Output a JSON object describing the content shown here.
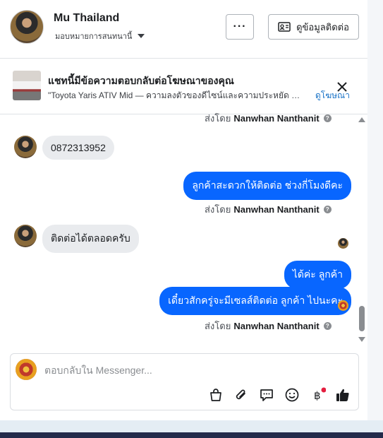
{
  "header": {
    "page_name": "Mu Thailand",
    "assignment_label": "มอบหมายการสนทนานี้",
    "more_label": "···",
    "contact_label": "ดูข้อมูลติดต่อ"
  },
  "ad_banner": {
    "title": "แชทนี้มีข้อความตอบกลับต่อโฆษณาของคุณ",
    "description": "\"Toyota Yaris ATIV Mid — ความลงตัวของดีไซน์และความประหยัด ✨\" ...",
    "view_ad_label": "ดูโฆษณา"
  },
  "messages": [
    {
      "type": "sent_by",
      "prefix": "ส่งโดย",
      "name": "Nanwhan Nanthanit"
    },
    {
      "type": "incoming",
      "text": "0872313952"
    },
    {
      "type": "outgoing",
      "text": "ลูกค้าสะดวกให้ติดต่อ ช่วงกี่โมงดีคะ"
    },
    {
      "type": "sent_by",
      "prefix": "ส่งโดย",
      "name": "Nanwhan Nanthanit"
    },
    {
      "type": "incoming",
      "text": "ติดต่อได้ตลอดครับ"
    },
    {
      "type": "outgoing",
      "text": "ได้ค่ะ  ลูกค้า"
    },
    {
      "type": "outgoing",
      "text": "เดี๋ยวสักครู่จะมีเซลส์ติดต่อ ลูกค้า  ไปนะคะ"
    },
    {
      "type": "sent_by",
      "prefix": "ส่งโดย",
      "name": "Nanwhan Nanthanit"
    }
  ],
  "composer": {
    "placeholder": "ตอบกลับใน Messenger...",
    "tools": [
      "bag-icon",
      "paperclip-icon",
      "chat-icon",
      "emoji-icon",
      "baht-icon",
      "like-icon"
    ]
  },
  "colors": {
    "accent": "#0866ff",
    "bubble_in": "#e9ebee",
    "link": "#1a73c7",
    "notification_dot": "#e41e3f"
  }
}
